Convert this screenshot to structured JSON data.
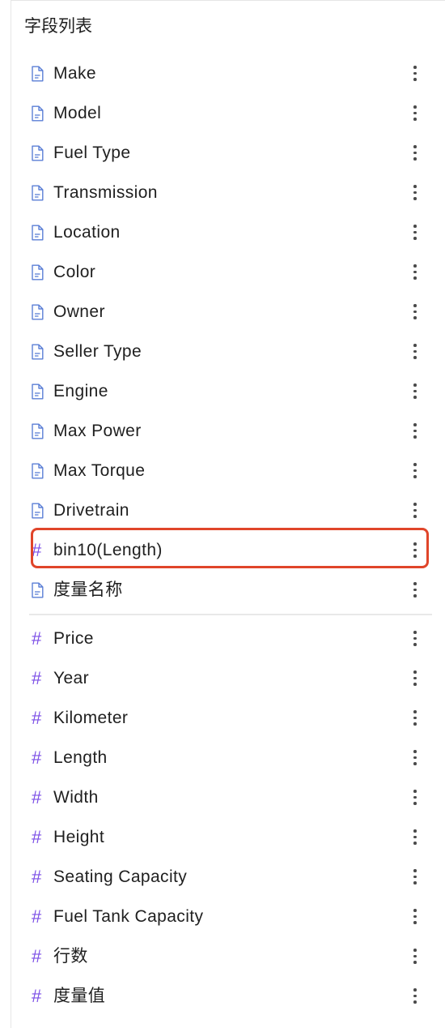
{
  "panel": {
    "title": "字段列表"
  },
  "dimensions": [
    {
      "label": "Make",
      "icon": "text-file-icon"
    },
    {
      "label": "Model",
      "icon": "text-file-icon"
    },
    {
      "label": "Fuel Type",
      "icon": "text-file-icon"
    },
    {
      "label": "Transmission",
      "icon": "text-file-icon"
    },
    {
      "label": "Location",
      "icon": "text-file-icon"
    },
    {
      "label": "Color",
      "icon": "text-file-icon"
    },
    {
      "label": "Owner",
      "icon": "text-file-icon"
    },
    {
      "label": "Seller Type",
      "icon": "text-file-icon"
    },
    {
      "label": "Engine",
      "icon": "text-file-icon"
    },
    {
      "label": "Max Power",
      "icon": "text-file-icon"
    },
    {
      "label": "Max Torque",
      "icon": "text-file-icon"
    },
    {
      "label": "Drivetrain",
      "icon": "text-file-icon"
    },
    {
      "label": "bin10(Length)",
      "icon": "hash-icon",
      "highlighted": true
    },
    {
      "label": "度量名称",
      "icon": "text-file-icon"
    }
  ],
  "measures": [
    {
      "label": "Price",
      "icon": "hash-icon"
    },
    {
      "label": "Year",
      "icon": "hash-icon"
    },
    {
      "label": "Kilometer",
      "icon": "hash-icon"
    },
    {
      "label": "Length",
      "icon": "hash-icon"
    },
    {
      "label": "Width",
      "icon": "hash-icon"
    },
    {
      "label": "Height",
      "icon": "hash-icon"
    },
    {
      "label": "Seating Capacity",
      "icon": "hash-icon"
    },
    {
      "label": "Fuel Tank Capacity",
      "icon": "hash-icon"
    },
    {
      "label": "行数",
      "icon": "hash-icon"
    },
    {
      "label": "度量值",
      "icon": "hash-icon"
    }
  ],
  "colors": {
    "text_file_icon": "#5b7fd6",
    "hash_icon": "#7b4ee6",
    "highlight_border": "#e0452a"
  }
}
